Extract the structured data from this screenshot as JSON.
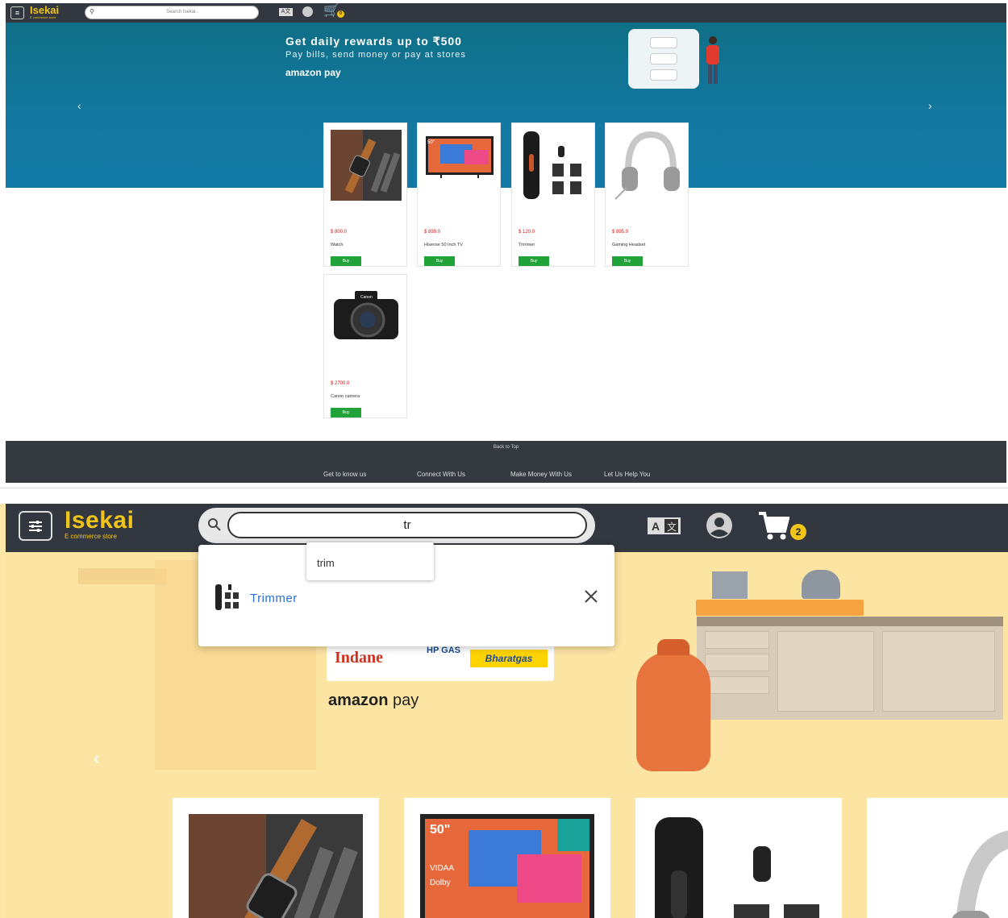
{
  "colors": {
    "nav": "#333840",
    "brand": "#f0c419",
    "buy": "#22a33a",
    "price": "#dd1111",
    "link": "#2a6fd6",
    "banner_top": "#137aa6",
    "banner_bottom": "#fce4a3"
  },
  "shot1": {
    "header": {
      "logo": "Isekai",
      "logo_sub": "E commerce store",
      "search_placeholder": "Search Isekai..",
      "cart_count": "0"
    },
    "banner": {
      "headline": "Get daily rewards up to ₹500",
      "subline": "Pay bills, send money or pay at stores",
      "brand": "amazon pay",
      "prev": "‹",
      "next": "›"
    },
    "products": [
      {
        "price": "$ 800.0",
        "name": "Watch",
        "buy": "Buy",
        "icon": "watch"
      },
      {
        "price": "$ 899.0",
        "name": "Hisense 50 Inch TV",
        "buy": "Buy",
        "icon": "tv"
      },
      {
        "price": "$ 120.0",
        "name": "Trimmer",
        "buy": "Buy",
        "icon": "trimmer"
      },
      {
        "price": "$ 895.0",
        "name": "Gaming Headset",
        "buy": "Buy",
        "icon": "headset"
      },
      {
        "price": "$ 2700.0",
        "name": "Canon camera",
        "buy": "Buy",
        "icon": "camera"
      }
    ],
    "footer": {
      "back_to_top": "Back to Top",
      "links": [
        "Get to know us",
        "Connect With Us",
        "Make Money With Us",
        "Let Us Help You"
      ]
    }
  },
  "shot2": {
    "header": {
      "logo": "Isekai",
      "logo_sub": "E commerce store",
      "search_value": "tr",
      "cart_count": "2"
    },
    "suggestion": "trim",
    "result": "Trimmer",
    "banner": {
      "brand_amazon": "amazon",
      "brand_pay": "pay",
      "logos": [
        "Indane",
        "HP GAS",
        "Bharatgas"
      ],
      "prev": "‹"
    }
  }
}
